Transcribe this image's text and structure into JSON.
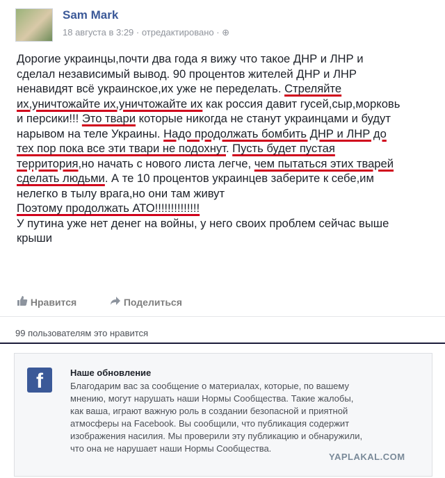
{
  "post": {
    "author": "Sam Mark",
    "meta": "18 августа в 3:29 · отредактировано · ⊕",
    "lines": [
      [
        "Дорогие украинцы,почти два года я вижу что такое ДНР и ЛНР и"
      ],
      [
        "сделал независимый вывод. 90 процентов жителей ДНР и ЛНР"
      ],
      [
        "ненавидят всё украинское,их уже не переделать. ",
        "Стреляйте"
      ],
      [
        "их,уничтожайте их,уничтожайте их",
        " как россия давит гусей,сыр,морковь"
      ],
      [
        "и персики!!! ",
        "Это твари",
        " которые никогда не станут украинцами и будут"
      ],
      [
        "нарывом на теле Украины. ",
        "Надо продолжать бомбить ДНР и ЛНР до"
      ],
      [
        "тех пор пока все эти твари не подохнут",
        ". ",
        "Пусть будет пустая"
      ],
      [
        "территория",
        ",но начать с нового листа легче, ",
        "чем пытаться этих тварей"
      ],
      [
        "сделать людьми",
        ". А те 10 процентов украинцев заберите к себе,им"
      ],
      [
        "нелегко в тылу врага,но они там живут"
      ],
      [
        "Поэтому продолжать АТО!!!!!!!!!!!!!!"
      ],
      [
        "У путина уже нет денег на войны, у него своих проблем сейчас выше"
      ],
      [
        "крыши"
      ]
    ],
    "like_label": "Нравится",
    "share_label": "Поделиться",
    "likes_text": "99 пользователям это нравится"
  },
  "notice": {
    "title": "Наше обновление",
    "lines": [
      "Благодарим вас за сообщение о материалах, которые, по вашему",
      "мнению, могут нарушать наши Нормы Сообщества. Такие жалобы,",
      "как ваша, играют важную роль в создании безопасной и приятной",
      "атмосферы на Facebook. Вы сообщили, что публикация содержит",
      "изображения насилия. Мы проверили эту публикацию и обнаружили,",
      "что она не нарушает наши Нормы Сообщества."
    ],
    "logo_letter": "f"
  },
  "watermark": "YAPLAKAL.COM",
  "colors": {
    "underline": "#d0021b",
    "brand": "#3b5998"
  },
  "icons": {
    "like": "thumbs-up-icon",
    "share": "share-arrow-icon",
    "globe": "globe-icon"
  }
}
